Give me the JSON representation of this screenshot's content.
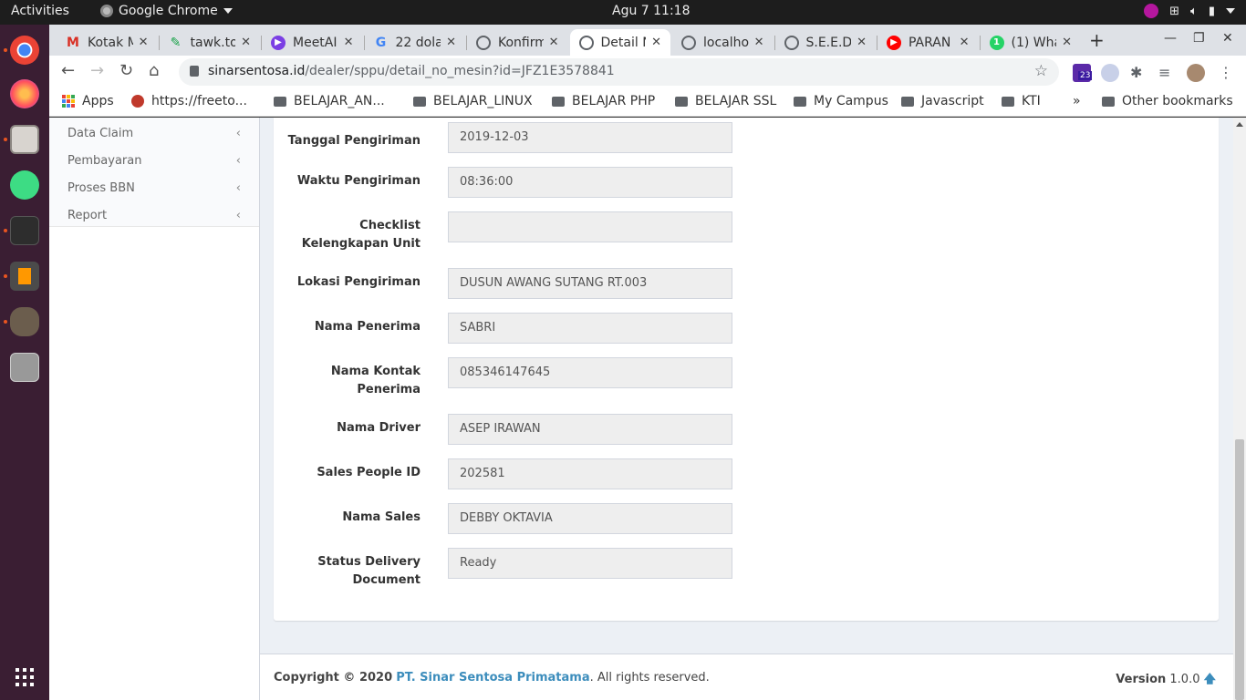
{
  "topbar": {
    "activities": "Activities",
    "app_name": "Google Chrome",
    "clock": "Agu 7  11:18"
  },
  "tabs": [
    {
      "title": "Kotak M",
      "favicon": "gmail-icon",
      "color": "#d93025"
    },
    {
      "title": "tawk.to",
      "favicon": "tawk-icon",
      "color": "#1aa34a"
    },
    {
      "title": "MeetAI",
      "favicon": "meet-icon",
      "color": "#7b3fe4"
    },
    {
      "title": "22 dola",
      "favicon": "google-icon",
      "color": "#4285f4"
    },
    {
      "title": "Konfirm",
      "favicon": "globe-icon",
      "color": "#5f6368"
    },
    {
      "title": "Detail N",
      "favicon": "globe-icon",
      "color": "#5f6368",
      "active": true
    },
    {
      "title": "localho",
      "favicon": "globe-icon",
      "color": "#5f6368"
    },
    {
      "title": "S.E.E.D",
      "favicon": "globe-icon",
      "color": "#5f6368"
    },
    {
      "title": "PARAN",
      "favicon": "youtube-icon",
      "color": "#ff0000"
    },
    {
      "title": "(1) Wha",
      "favicon": "whatsapp-icon",
      "color": "#25d366"
    }
  ],
  "toolbar": {
    "url_host": "sinarsentosa.id",
    "url_path": "/dealer/sppu/detail_no_mesin?id=JFZ1E3578841",
    "ext_badge": "23"
  },
  "bookmarks": {
    "apps": "Apps",
    "items": [
      "https://freeto...",
      "BELAJAR_AN...",
      "BELAJAR_LINUX",
      "BELAJAR PHP",
      "BELAJAR SSL",
      "My Campus",
      "Javascript",
      "KTI"
    ],
    "overflow": "»",
    "other": "Other bookmarks"
  },
  "sidebar": {
    "items": [
      {
        "label": "Data Claim"
      },
      {
        "label": "Pembayaran"
      },
      {
        "label": "Proses BBN"
      },
      {
        "label": "Report"
      }
    ]
  },
  "form": {
    "fields": [
      {
        "label": "Tanggal Pengiriman",
        "value": "2019-12-03"
      },
      {
        "label": "Waktu Pengiriman",
        "value": "08:36:00"
      },
      {
        "label": "Checklist Kelengkapan Unit",
        "value": ""
      },
      {
        "label": "Lokasi Pengiriman",
        "value": "DUSUN AWANG SUTANG RT.003"
      },
      {
        "label": "Nama Penerima",
        "value": "SABRI"
      },
      {
        "label": "Nama Kontak Penerima",
        "value": "085346147645"
      },
      {
        "label": "Nama Driver",
        "value": "ASEP IRAWAN"
      },
      {
        "label": "Sales People ID",
        "value": "202581"
      },
      {
        "label": "Nama Sales",
        "value": "DEBBY OKTAVIA"
      },
      {
        "label": "Status Delivery Document",
        "value": "Ready"
      }
    ]
  },
  "footer": {
    "copyright": "Copyright © 2020",
    "company": "PT. Sinar Sentosa Primatama",
    "rights": ". All rights reserved.",
    "version_label": "Version",
    "version": "1.0.0"
  }
}
